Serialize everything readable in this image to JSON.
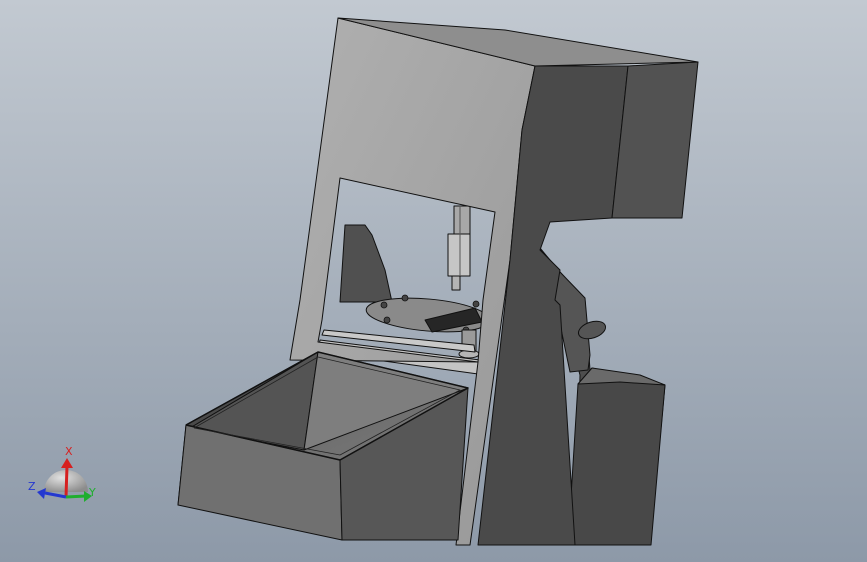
{
  "viewport": {
    "background_top": "#c2c9d1",
    "background_bottom": "#8d99a8"
  },
  "model": {
    "face_light": "#a5a5a5",
    "face_mid": "#6f6f6f",
    "face_dark": "#4e4e4e",
    "face_darkest": "#3e3e3e",
    "edge": "#111111",
    "steel": "#b8b8b8"
  },
  "triad": {
    "x_label": "X",
    "y_label": "Y",
    "z_label": "Z",
    "x_color": "#d62020",
    "y_color": "#1fae2e",
    "z_color": "#2438d0"
  }
}
